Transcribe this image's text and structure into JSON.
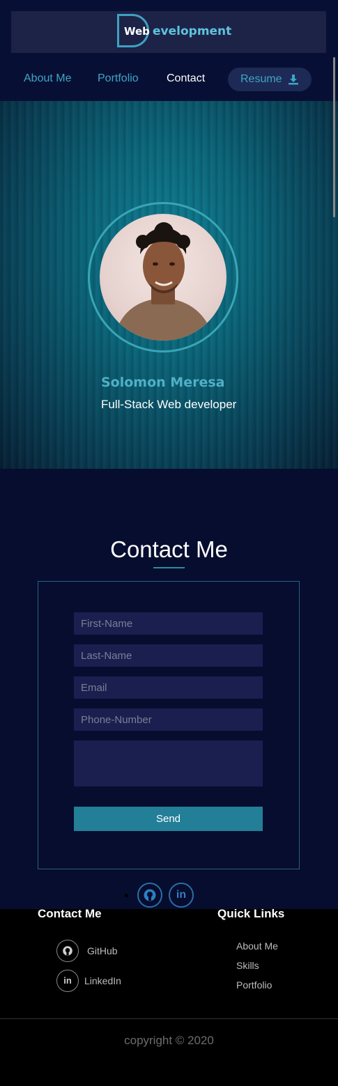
{
  "logo": {
    "web": "Web",
    "rest": "evelopment"
  },
  "nav": {
    "about": "About Me",
    "portfolio": "Portfolio",
    "contact": "Contact",
    "resume": "Resume"
  },
  "hero": {
    "name": "Solomon Meresa",
    "role": "Full-Stack Web developer"
  },
  "contact": {
    "title": "Contact Me",
    "placeholders": {
      "first": "First-Name",
      "last": "Last-Name",
      "email": "Email",
      "phone": "Phone-Number"
    },
    "send": "Send"
  },
  "social": {
    "github": "⊙",
    "linkedin": "in"
  },
  "footer": {
    "contact_heading": "Contact Me",
    "quick_heading": "Quick Links",
    "github": "GitHub",
    "linkedin": "LinkedIn",
    "github_icon": "⊙",
    "linkedin_icon": "in",
    "links": [
      "About Me",
      "Skills",
      "Portfolio"
    ],
    "copyright": "copyright © 2020"
  },
  "colors": {
    "accent": "#3fa5c5",
    "navy": "#060d2e",
    "button": "#237e98"
  }
}
